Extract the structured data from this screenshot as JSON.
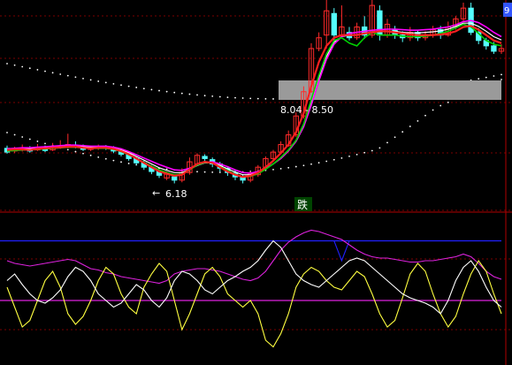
{
  "colors": {
    "background": "#000000",
    "grid": "#7a0000",
    "separator": "#b00000",
    "up_candle": "#ff2a2a",
    "down_candle": "#54ffff",
    "ma_fast": "#ff2020",
    "ma_green": "#00d000",
    "ma_magenta": "#ff00ff",
    "ma_white": "#ffffff",
    "dots": "#ffffff",
    "price_band": "#9a9a9a",
    "osc_blue": "#2020ff",
    "osc_magenta": "#dd22dd",
    "osc_yellow": "#ffff40",
    "osc_white": "#ffffff",
    "axis_tab": "#3355ff"
  },
  "labels": {
    "band_label": "8.04 - 8.50",
    "low_label": "6.18",
    "low_arrow": "←",
    "signal_text": "跌",
    "corner_tab": "9"
  },
  "chart_data": [
    {
      "type": "candlestick",
      "title": "",
      "price_range_label": "8.04 - 8.50",
      "annotated_low": 6.18,
      "ylim": [
        5.8,
        9.7
      ],
      "candles": [
        [
          6.95,
          6.88,
          7.0,
          6.85
        ],
        [
          6.9,
          6.93,
          6.98,
          6.86
        ],
        [
          6.92,
          6.95,
          7.02,
          6.89
        ],
        [
          6.95,
          6.9,
          6.99,
          6.87
        ],
        [
          6.92,
          6.97,
          7.03,
          6.9
        ],
        [
          6.96,
          6.91,
          7.0,
          6.88
        ],
        [
          6.92,
          6.98,
          7.05,
          6.9
        ],
        [
          6.97,
          6.99,
          7.1,
          6.94
        ],
        [
          6.99,
          7.02,
          7.22,
          6.95
        ],
        [
          7.01,
          6.99,
          7.08,
          6.95
        ],
        [
          6.99,
          6.93,
          7.02,
          6.9
        ],
        [
          6.93,
          6.96,
          7.0,
          6.9
        ],
        [
          6.95,
          6.98,
          7.02,
          6.92
        ],
        [
          6.97,
          6.95,
          7.01,
          6.92
        ],
        [
          6.96,
          6.9,
          6.99,
          6.86
        ],
        [
          6.9,
          6.84,
          6.93,
          6.8
        ],
        [
          6.84,
          6.76,
          6.87,
          6.72
        ],
        [
          6.76,
          6.68,
          6.8,
          6.64
        ],
        [
          6.68,
          6.6,
          6.72,
          6.55
        ],
        [
          6.6,
          6.52,
          6.64,
          6.47
        ],
        [
          6.52,
          6.45,
          6.56,
          6.4
        ],
        [
          6.4,
          6.47,
          6.52,
          6.36
        ],
        [
          6.42,
          6.36,
          6.45,
          6.3
        ],
        [
          6.36,
          6.5,
          6.58,
          6.32
        ],
        [
          6.5,
          6.7,
          6.78,
          6.46
        ],
        [
          6.66,
          6.82,
          6.86,
          6.62
        ],
        [
          6.8,
          6.76,
          6.84,
          6.7
        ],
        [
          6.74,
          6.66,
          6.78,
          6.6
        ],
        [
          6.66,
          6.58,
          6.7,
          6.52
        ],
        [
          6.58,
          6.5,
          6.62,
          6.44
        ],
        [
          6.5,
          6.42,
          6.55,
          6.36
        ],
        [
          6.42,
          6.36,
          6.47,
          6.3
        ],
        [
          6.36,
          6.48,
          6.52,
          6.32
        ],
        [
          6.46,
          6.6,
          6.64,
          6.42
        ],
        [
          6.6,
          6.76,
          6.8,
          6.56
        ],
        [
          6.76,
          6.88,
          6.92,
          6.72
        ],
        [
          6.88,
          7.02,
          7.08,
          6.84
        ],
        [
          7.0,
          7.2,
          7.28,
          6.98
        ],
        [
          7.2,
          7.55,
          7.62,
          7.16
        ],
        [
          7.55,
          8.0,
          8.1,
          7.5
        ],
        [
          8.0,
          8.8,
          8.9,
          7.98
        ],
        [
          8.8,
          9.0,
          9.1,
          8.75
        ],
        [
          9.05,
          9.5,
          9.72,
          8.8
        ],
        [
          9.45,
          9.05,
          9.55,
          8.95
        ],
        [
          9.05,
          9.2,
          9.6,
          9.0
        ],
        [
          9.1,
          9.0,
          9.2,
          8.95
        ],
        [
          9.0,
          9.2,
          9.28,
          8.96
        ],
        [
          9.2,
          9.05,
          9.4,
          8.98
        ],
        [
          9.05,
          9.6,
          9.7,
          9.0
        ],
        [
          9.5,
          9.05,
          9.6,
          8.95
        ],
        [
          9.05,
          9.25,
          9.35,
          9.0
        ],
        [
          9.15,
          9.05,
          9.22,
          8.98
        ],
        [
          9.05,
          9.0,
          9.12,
          8.92
        ],
        [
          9.0,
          9.1,
          9.2,
          8.94
        ],
        [
          9.1,
          9.0,
          9.15,
          8.94
        ],
        [
          9.0,
          9.05,
          9.12,
          8.95
        ],
        [
          9.05,
          9.15,
          9.22,
          9.0
        ],
        [
          9.15,
          9.05,
          9.22,
          8.98
        ],
        [
          9.05,
          9.2,
          9.3,
          9.02
        ],
        [
          9.2,
          9.35,
          9.4,
          9.15
        ],
        [
          9.35,
          9.55,
          9.65,
          9.3
        ],
        [
          9.55,
          9.1,
          9.65,
          9.05
        ],
        [
          9.1,
          8.95,
          9.18,
          8.88
        ],
        [
          8.95,
          8.85,
          9.0,
          8.78
        ],
        [
          8.85,
          8.75,
          8.92,
          8.7
        ],
        [
          8.75,
          8.8,
          8.88,
          8.7
        ]
      ],
      "ma_lines": {
        "red": [
          6.92,
          6.93,
          6.93,
          6.92,
          6.94,
          6.95,
          6.96,
          6.97,
          6.98,
          6.98,
          6.96,
          6.95,
          6.96,
          6.96,
          6.94,
          6.9,
          6.84,
          6.76,
          6.68,
          6.6,
          6.52,
          6.48,
          6.44,
          6.46,
          6.56,
          6.66,
          6.7,
          6.68,
          6.6,
          6.52,
          6.46,
          6.42,
          6.44,
          6.5,
          6.6,
          6.72,
          6.86,
          7.02,
          7.25,
          7.6,
          8.1,
          8.55,
          8.85,
          9.0,
          9.05,
          9.05,
          9.05,
          9.08,
          9.1,
          9.12,
          9.12,
          9.1,
          9.08,
          9.06,
          9.05,
          9.05,
          9.05,
          9.06,
          9.08,
          9.12,
          9.2,
          9.22,
          9.15,
          9.05,
          8.95,
          8.9
        ],
        "green": [
          6.9,
          6.91,
          6.92,
          6.92,
          6.93,
          6.94,
          6.95,
          6.96,
          6.97,
          6.97,
          6.96,
          6.95,
          6.95,
          6.95,
          6.93,
          6.89,
          6.83,
          6.76,
          6.69,
          6.62,
          6.55,
          6.5,
          6.46,
          6.47,
          6.55,
          6.64,
          6.69,
          6.68,
          6.61,
          6.54,
          6.47,
          6.42,
          6.43,
          6.48,
          6.56,
          6.66,
          6.78,
          6.92,
          7.1,
          7.4,
          7.85,
          8.3,
          8.7,
          8.95,
          9.0,
          8.9,
          8.85,
          9.0,
          9.1,
          9.05,
          9.05,
          9.05,
          9.03,
          9.02,
          9.02,
          9.03,
          9.05,
          9.08,
          9.12,
          9.18,
          9.25,
          9.2,
          9.08,
          8.95,
          8.88,
          8.85
        ],
        "magenta": [
          6.94,
          6.95,
          6.96,
          6.96,
          6.97,
          6.98,
          6.99,
          7.0,
          7.01,
          7.01,
          7.0,
          6.99,
          6.99,
          6.99,
          6.97,
          6.94,
          6.89,
          6.83,
          6.77,
          6.71,
          6.65,
          6.6,
          6.55,
          6.54,
          6.58,
          6.64,
          6.69,
          6.7,
          6.66,
          6.61,
          6.55,
          6.5,
          6.49,
          6.52,
          6.58,
          6.66,
          6.76,
          6.9,
          7.08,
          7.35,
          7.75,
          8.2,
          8.6,
          8.88,
          9.02,
          9.08,
          9.1,
          9.12,
          9.14,
          9.15,
          9.16,
          9.16,
          9.15,
          9.14,
          9.14,
          9.15,
          9.16,
          9.18,
          9.2,
          9.24,
          9.3,
          9.32,
          9.28,
          9.2,
          9.1,
          9.02
        ],
        "white": [
          6.93,
          6.94,
          6.94,
          6.94,
          6.95,
          6.96,
          6.97,
          6.98,
          6.99,
          6.99,
          6.98,
          6.97,
          6.97,
          6.97,
          6.95,
          6.92,
          6.87,
          6.8,
          6.73,
          6.66,
          6.59,
          6.54,
          6.5,
          6.5,
          6.56,
          6.63,
          6.68,
          6.68,
          6.63,
          6.57,
          6.51,
          6.46,
          6.46,
          6.5,
          6.57,
          6.66,
          6.77,
          6.91,
          7.09,
          7.38,
          7.8,
          8.25,
          8.65,
          8.92,
          9.02,
          9.05,
          9.06,
          9.08,
          9.11,
          9.12,
          9.12,
          9.12,
          9.1,
          9.09,
          9.09,
          9.1,
          9.11,
          9.13,
          9.16,
          9.21,
          9.27,
          9.27,
          9.21,
          9.12,
          9.02,
          8.96
        ]
      }
    },
    {
      "type": "line",
      "title": "",
      "ylim": [
        0,
        100
      ],
      "reference_levels": [
        85,
        40
      ],
      "series": [
        {
          "color_key": "osc_blue",
          "values": [
            85,
            85,
            85,
            85,
            85,
            85,
            85,
            85,
            85,
            85,
            85,
            85,
            85,
            85,
            85,
            85,
            85,
            85,
            85,
            85,
            85,
            85,
            85,
            85,
            85,
            85,
            85,
            85,
            85,
            85,
            85,
            85,
            85,
            85,
            85,
            85,
            85,
            85,
            85,
            85,
            85,
            85,
            85,
            85,
            70,
            85,
            85,
            85,
            85,
            85,
            85,
            85,
            85,
            85,
            85,
            85,
            85,
            85,
            85,
            85,
            85,
            85,
            85,
            85,
            85,
            85
          ]
        },
        {
          "color_key": "osc_magenta",
          "values": [
            70,
            68,
            67,
            66,
            67,
            68,
            69,
            70,
            71,
            70,
            67,
            64,
            63,
            61,
            60,
            58,
            57,
            56,
            55,
            54,
            53,
            55,
            60,
            62,
            63,
            64,
            64,
            63,
            62,
            60,
            58,
            56,
            55,
            57,
            62,
            70,
            78,
            84,
            88,
            91,
            93,
            92,
            90,
            88,
            86,
            82,
            78,
            75,
            73,
            72,
            72,
            71,
            70,
            69,
            69,
            70,
            70,
            71,
            72,
            73,
            75,
            73,
            68,
            62,
            58,
            56
          ]
        },
        {
          "color_key": "osc_yellow",
          "values": [
            50,
            35,
            20,
            25,
            40,
            55,
            62,
            50,
            30,
            22,
            28,
            40,
            55,
            65,
            60,
            45,
            35,
            30,
            50,
            60,
            68,
            62,
            40,
            18,
            30,
            45,
            60,
            65,
            58,
            45,
            40,
            35,
            40,
            30,
            10,
            5,
            15,
            30,
            50,
            60,
            65,
            62,
            55,
            50,
            48,
            55,
            62,
            58,
            45,
            30,
            20,
            25,
            42,
            60,
            68,
            62,
            45,
            30,
            20,
            28,
            45,
            60,
            70,
            62,
            45,
            30
          ]
        },
        {
          "color_key": "osc_white",
          "values": [
            55,
            60,
            52,
            45,
            40,
            38,
            42,
            48,
            58,
            65,
            62,
            55,
            45,
            40,
            35,
            38,
            45,
            52,
            48,
            40,
            35,
            42,
            55,
            62,
            60,
            55,
            48,
            45,
            50,
            55,
            58,
            62,
            65,
            70,
            78,
            85,
            80,
            70,
            60,
            55,
            52,
            50,
            55,
            60,
            65,
            70,
            72,
            70,
            65,
            60,
            55,
            50,
            45,
            42,
            40,
            38,
            35,
            30,
            40,
            55,
            65,
            70,
            62,
            50,
            40,
            35
          ]
        }
      ]
    }
  ]
}
